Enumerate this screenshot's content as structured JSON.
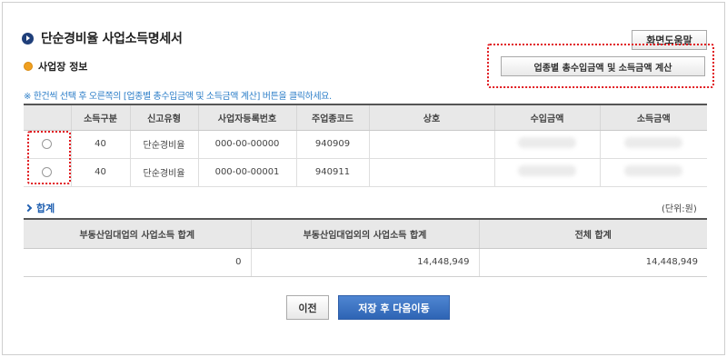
{
  "page": {
    "title": "단순경비율 사업소득명세서",
    "help_button": "화면도움말"
  },
  "section": {
    "title": "사업장 정보",
    "calc_button": "업종별 총수입금액 및 소득금액 계산",
    "note": "※ 한건씩 선택 후 오른쪽의 [업종별 총수입금액 및 소득금액 계산] 버튼을 클릭하세요."
  },
  "business_table": {
    "columns": [
      "",
      "소득구분",
      "신고유형",
      "사업자등록번호",
      "주업종코드",
      "상호",
      "수입금액",
      "소득금액"
    ],
    "rows": [
      {
        "selected": false,
        "income_type": "40",
        "report_type": "단순경비율",
        "reg_no": "000-00-00000",
        "industry_code": "940909",
        "name": "",
        "revenue": "",
        "income": ""
      },
      {
        "selected": false,
        "income_type": "40",
        "report_type": "단순경비율",
        "reg_no": "000-00-00001",
        "industry_code": "940911",
        "name": "",
        "revenue": "",
        "income": ""
      }
    ]
  },
  "summary": {
    "title": "합계",
    "unit": "(단위:원)",
    "columns": [
      "부동산임대업의 사업소득 합계",
      "부동산임대업외의 사업소득 합계",
      "전체 합계"
    ],
    "values": [
      "0",
      "14,448,949",
      "14,448,949"
    ]
  },
  "actions": {
    "prev": "이전",
    "save_next": "저장 후 다음이동"
  },
  "colors": {
    "highlight_border": "#e0161b",
    "primary_button": "#2e64b4",
    "note_text": "#2c7ec8",
    "title_bullet": "#1f3f7a",
    "section_bullet": "#f0a020"
  }
}
